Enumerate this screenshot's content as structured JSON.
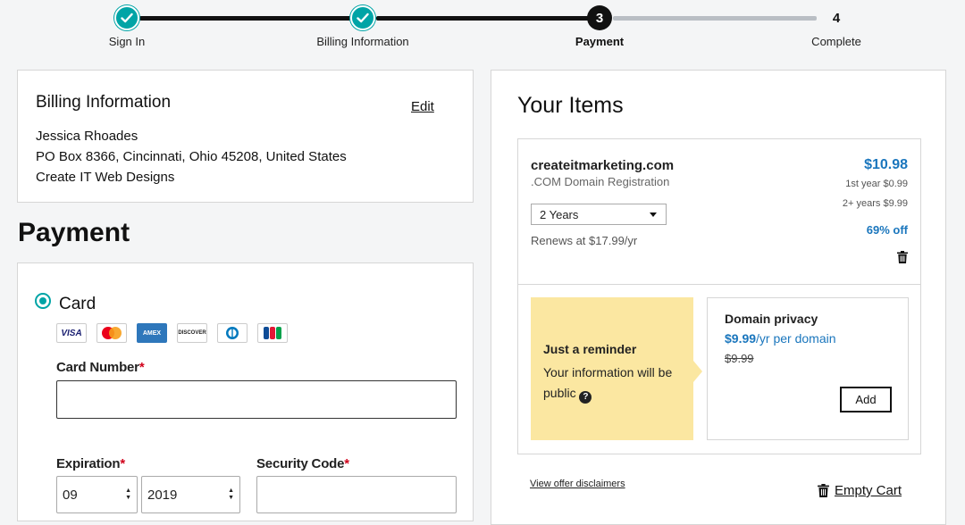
{
  "stepper": {
    "steps": [
      {
        "label": "Sign In",
        "state": "done"
      },
      {
        "label": "Billing Information",
        "state": "done"
      },
      {
        "label": "Payment",
        "number": "3",
        "state": "current"
      },
      {
        "label": "Complete",
        "number": "4",
        "state": "todo"
      }
    ],
    "colors": {
      "done": "#00a4a6",
      "current": "#111111",
      "pending_line": "#b9bec4"
    }
  },
  "billing": {
    "title": "Billing Information",
    "edit_label": "Edit",
    "name": "Jessica Rhoades",
    "address": "PO Box 8366, Cincinnati, Ohio 45208, United States",
    "company": "Create IT Web Designs"
  },
  "payment": {
    "title": "Payment",
    "method_label": "Card",
    "method_selected": true,
    "card_brands": [
      "VISA",
      "mastercard-icon",
      "AMEX",
      "DISCOVER",
      "diners-icon",
      "jcb-icon"
    ],
    "card_number": {
      "label": "Card Number",
      "required_mark": "*",
      "value": ""
    },
    "expiration": {
      "label": "Expiration",
      "required_mark": "*",
      "month": "09",
      "year": "2019"
    },
    "security_code": {
      "label": "Security Code",
      "required_mark": "*",
      "value": ""
    }
  },
  "items": {
    "title": "Your Items",
    "item": {
      "domain": "createitmarketing.com",
      "product": ".COM Domain Registration",
      "price": "$10.98",
      "first_year": "1st year $0.99",
      "later_years": "2+ years $9.99",
      "discount": "69% off",
      "term": "2 Years",
      "renews": "Renews at $17.99/yr"
    },
    "reminder": {
      "title": "Just a reminder",
      "body": "Your information will be public"
    },
    "privacy": {
      "title": "Domain privacy",
      "price": "$9.99",
      "unit": "/yr per domain",
      "old_price": "$9.99",
      "add_label": "Add"
    },
    "disclaimers_label": "View offer disclaimers",
    "empty_cart_label": "Empty Cart"
  }
}
